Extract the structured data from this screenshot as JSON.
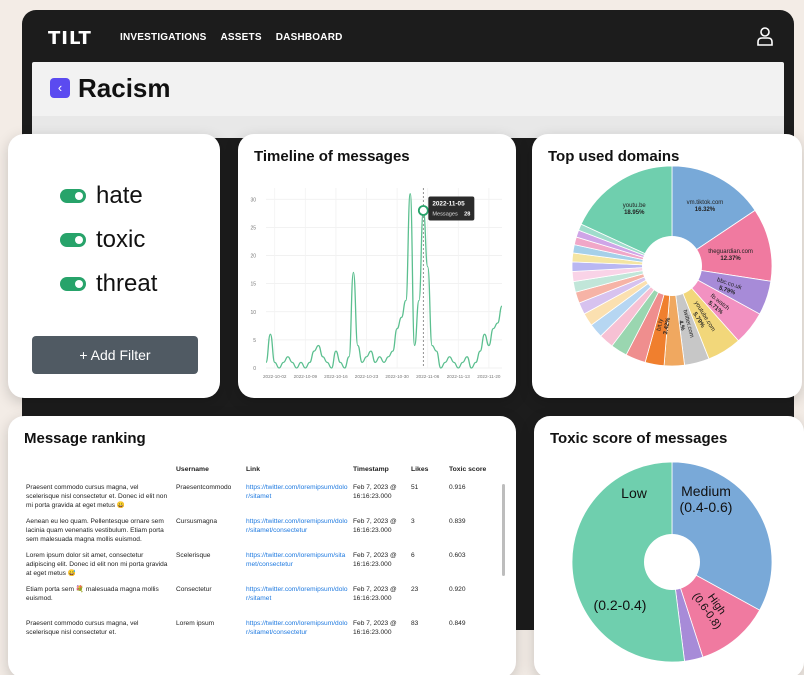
{
  "app": {
    "logo": "TILT",
    "nav": [
      "INVESTIGATIONS",
      "ASSETS",
      "DASHBOARD"
    ]
  },
  "page": {
    "back_icon": "chevron-left-icon",
    "title": "Racism"
  },
  "filters": {
    "items": [
      "hate",
      "toxic",
      "threat"
    ],
    "add_button": "+ Add Filter",
    "toggle_color": "#27a36a"
  },
  "timeline": {
    "title": "Timeline of messages",
    "tooltip": {
      "date": "2022-11-05",
      "label": "Messages",
      "value": "28"
    }
  },
  "domains": {
    "title": "Top used domains"
  },
  "ranking": {
    "title": "Message ranking",
    "columns": [
      "Username",
      "Link",
      "Timestamp",
      "Likes",
      "Toxic score"
    ],
    "rows": [
      {
        "message": "Praesent commodo cursus magna, vel scelerisque nisl consectetur et. Donec id elit non mi porta gravida at eget metus 😀",
        "username": "Praesentcommodo",
        "link": "https://twitter.com/loremipsum/dolor/sitamet",
        "timestamp": "Feb 7, 2023 @ 16:16:23.000",
        "likes": "51",
        "score": "0.916"
      },
      {
        "message": "Aenean eu leo quam. Pellentesque ornare sem lacinia quam venenatis vestibulum. Etiam porta sem malesuada magna mollis euismod.",
        "username": "Cursusmagna",
        "link": "https://twitter.com/loremipsum/dolor/sitamet/consectetur",
        "timestamp": "Feb 7, 2023 @ 16:16:23.000",
        "likes": "3",
        "score": "0.839"
      },
      {
        "message": "Lorem ipsum dolor sit amet, consectetur adipiscing elit. Donec id elit non mi porta gravida at eget metus 😅",
        "username": "Scelerisque",
        "link": "https://twitter.com/loremipsum/sitamet/consectetur",
        "timestamp": "Feb 7, 2023 @ 16:16:23.000",
        "likes": "6",
        "score": "0.603"
      },
      {
        "message": "Etiam porta sem 💐 malesuada magna mollis euismod.",
        "username": "Consectetur",
        "link": "https://twitter.com/loremipsum/dolor/sitamet",
        "timestamp": "Feb 7, 2023 @ 16:16:23.000",
        "likes": "23",
        "score": "0.920"
      },
      {
        "message": "Praesent commodo cursus magna, vel scelerisque nisl consectetur et.",
        "username": "Lorem ipsum",
        "link": "https://twitter.com/loremipsum/dolor/sitamet/consectetur",
        "timestamp": "Feb 7, 2023 @ 16:16:23.000",
        "likes": "83",
        "score": "0.849"
      }
    ]
  },
  "toxic": {
    "title": "Toxic score of messages"
  },
  "chart_data": [
    {
      "type": "line",
      "title": "Timeline of messages",
      "x_ticks": [
        "2022-10-02",
        "2022-10-09",
        "2022-10-16",
        "2022-10-23",
        "2022-10-30",
        "2022-11-06",
        "2022-11-13",
        "2022-11-20"
      ],
      "y_ticks": [
        "0",
        "5",
        "10",
        "15",
        "20",
        "25",
        "30"
      ],
      "ylim": [
        0,
        32
      ],
      "x": [
        "2022-09-30",
        "2022-10-01",
        "2022-10-02",
        "2022-10-03",
        "2022-10-04",
        "2022-10-05",
        "2022-10-06",
        "2022-10-07",
        "2022-10-08",
        "2022-10-09",
        "2022-10-10",
        "2022-10-11",
        "2022-10-12",
        "2022-10-13",
        "2022-10-14",
        "2022-10-15",
        "2022-10-16",
        "2022-10-17",
        "2022-10-18",
        "2022-10-19",
        "2022-10-20",
        "2022-10-21",
        "2022-10-22",
        "2022-10-23",
        "2022-10-24",
        "2022-10-25",
        "2022-10-26",
        "2022-10-27",
        "2022-10-28",
        "2022-10-29",
        "2022-10-30",
        "2022-10-31",
        "2022-11-01",
        "2022-11-02",
        "2022-11-03",
        "2022-11-04",
        "2022-11-05",
        "2022-11-06",
        "2022-11-07",
        "2022-11-08",
        "2022-11-09",
        "2022-11-10",
        "2022-11-11",
        "2022-11-12",
        "2022-11-13",
        "2022-11-14",
        "2022-11-15",
        "2022-11-16",
        "2022-11-17",
        "2022-11-18",
        "2022-11-19",
        "2022-11-20",
        "2022-11-21",
        "2022-11-22",
        "2022-11-23"
      ],
      "y": [
        1,
        6,
        1,
        0,
        1,
        2,
        1,
        0,
        1,
        0,
        1,
        3,
        4,
        2,
        1,
        0,
        3,
        1,
        0,
        2,
        17,
        4,
        1,
        2,
        3,
        1,
        2,
        1,
        2,
        3,
        7,
        9,
        12,
        31,
        4,
        12,
        28,
        18,
        4,
        3,
        0,
        1,
        2,
        1,
        0,
        1,
        2,
        0,
        1,
        3,
        6,
        4,
        7,
        8,
        11
      ],
      "line_color": "#5bbf8f",
      "highlight": {
        "x": "2022-11-05",
        "y": 28
      }
    },
    {
      "type": "pie",
      "title": "Top used domains",
      "style": "donut",
      "labels": [
        "vm.tiktok.com",
        "theguardian.com",
        "bbc.co.uk",
        "fb.watch",
        "youtube.com",
        "",
        "",
        "",
        "",
        "",
        "",
        "",
        "",
        "",
        "",
        "",
        "",
        "",
        "",
        "",
        "",
        "",
        "",
        "youtu.be"
      ],
      "values": [
        16.32,
        12.37,
        5.79,
        5.71,
        5.79,
        4.2,
        3.42,
        3.2,
        3.4,
        2.8,
        2.5,
        2.4,
        2.2,
        2.0,
        1.9,
        1.8,
        1.7,
        1.6,
        1.5,
        1.4,
        1.3,
        1.2,
        1.1,
        18.95
      ],
      "slice_labels": [
        "vm.tiktok.com 16.32%",
        "theguardian.com 12.37%",
        "bbc.co.uk 5.79%",
        "fb.watch 5.71%",
        "youtube.com 5.79%",
        "twitter.com 4.%",
        "",
        "bit.ly 3.42%",
        "",
        "",
        "",
        "",
        "",
        "",
        "",
        "",
        "",
        "",
        "",
        "",
        "",
        "",
        "",
        "youtu.be 18.95%"
      ],
      "colors": [
        "#78a9d8",
        "#f07aa0",
        "#a78bd8",
        "#f291c1",
        "#f2d77a",
        "#c7c7c7",
        "#f0a860",
        "#f07f2e",
        "#ef8e8e",
        "#9ad6b0",
        "#f7c1d4",
        "#b6d6f2",
        "#fbe0b0",
        "#d7c2ef",
        "#f6b3a6",
        "#c1e6d9",
        "#f9d3e7",
        "#b9b7f2",
        "#f4e5a2",
        "#a5d0e9",
        "#f1a7c8",
        "#cfa5e7",
        "#9fdccb",
        "#6fcfae"
      ]
    },
    {
      "type": "pie",
      "title": "Toxic score of messages",
      "style": "donut",
      "labels": [
        "Medium (0.4-0.6)",
        "High (0.6-0.8)",
        "",
        "Low (0.2-0.4)"
      ],
      "values": [
        33,
        12,
        3,
        52
      ],
      "colors": [
        "#79a9d8",
        "#f07aa0",
        "#a78bd8",
        "#6fcfae"
      ]
    }
  ]
}
